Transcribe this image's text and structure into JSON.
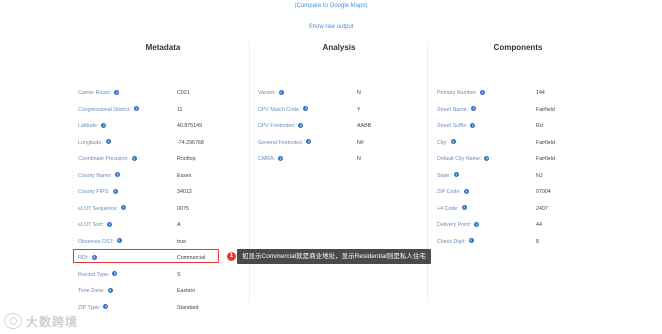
{
  "links": {
    "compare": "(Compare to Google Maps)",
    "raw": "Show raw output"
  },
  "metadata": {
    "title": "Metadata",
    "rows": [
      {
        "label": "Carrier Route:",
        "value": "C021"
      },
      {
        "label": "Congressional District:",
        "value": "11"
      },
      {
        "label": "Latitude:",
        "value": "40.875149"
      },
      {
        "label": "Longitude:",
        "value": "-74.296768"
      },
      {
        "label": "Coordinate Precision:",
        "value": "Rooftop"
      },
      {
        "label": "County Name:",
        "value": "Essex"
      },
      {
        "label": "County FIPS:",
        "value": "34013"
      },
      {
        "label": "eLOT Sequence:",
        "value": "0075"
      },
      {
        "label": "eLOT Sort:",
        "value": "A"
      },
      {
        "label": "Observes DST:",
        "value": "true"
      },
      {
        "label": "RDI:",
        "value": "Commercial"
      },
      {
        "label": "Record Type:",
        "value": "S"
      },
      {
        "label": "Time Zone:",
        "value": "Eastern"
      },
      {
        "label": "ZIP Type:",
        "value": "Standard"
      }
    ]
  },
  "analysis": {
    "title": "Analysis",
    "rows": [
      {
        "label": "Vacant:",
        "value": "N"
      },
      {
        "label": "DPV Match Code:",
        "value": "Y"
      },
      {
        "label": "DPV Footnotes:",
        "value": "AABB"
      },
      {
        "label": "General Footnotes:",
        "value": "N#"
      },
      {
        "label": "CMRA:",
        "value": "N"
      }
    ]
  },
  "components": {
    "title": "Components",
    "rows": [
      {
        "label": "Primary Number:",
        "value": "144"
      },
      {
        "label": "Street Name:",
        "value": "Fairfield"
      },
      {
        "label": "Street Suffix:",
        "value": "Rd"
      },
      {
        "label": "City:",
        "value": "Fairfield"
      },
      {
        "label": "Default City Name:",
        "value": "Fairfield"
      },
      {
        "label": "State:",
        "value": "NJ"
      },
      {
        "label": "ZIP Code:",
        "value": "07004"
      },
      {
        "label": "+4 Code:",
        "value": "2407"
      },
      {
        "label": "Delivery Point:",
        "value": "44"
      },
      {
        "label": "Check Digit:",
        "value": "8"
      }
    ]
  },
  "annotation": {
    "badge": "1",
    "text": "如显示Commercial就是商业地址，显示Residential则是私人住宅"
  },
  "watermark": {
    "text": "大数跨境"
  },
  "colors": {
    "accent": "#e53935",
    "link": "#4a8fd6",
    "label": "#6b8db5",
    "help_icon": "#2f6fc2"
  },
  "help_icon_glyph": "?"
}
